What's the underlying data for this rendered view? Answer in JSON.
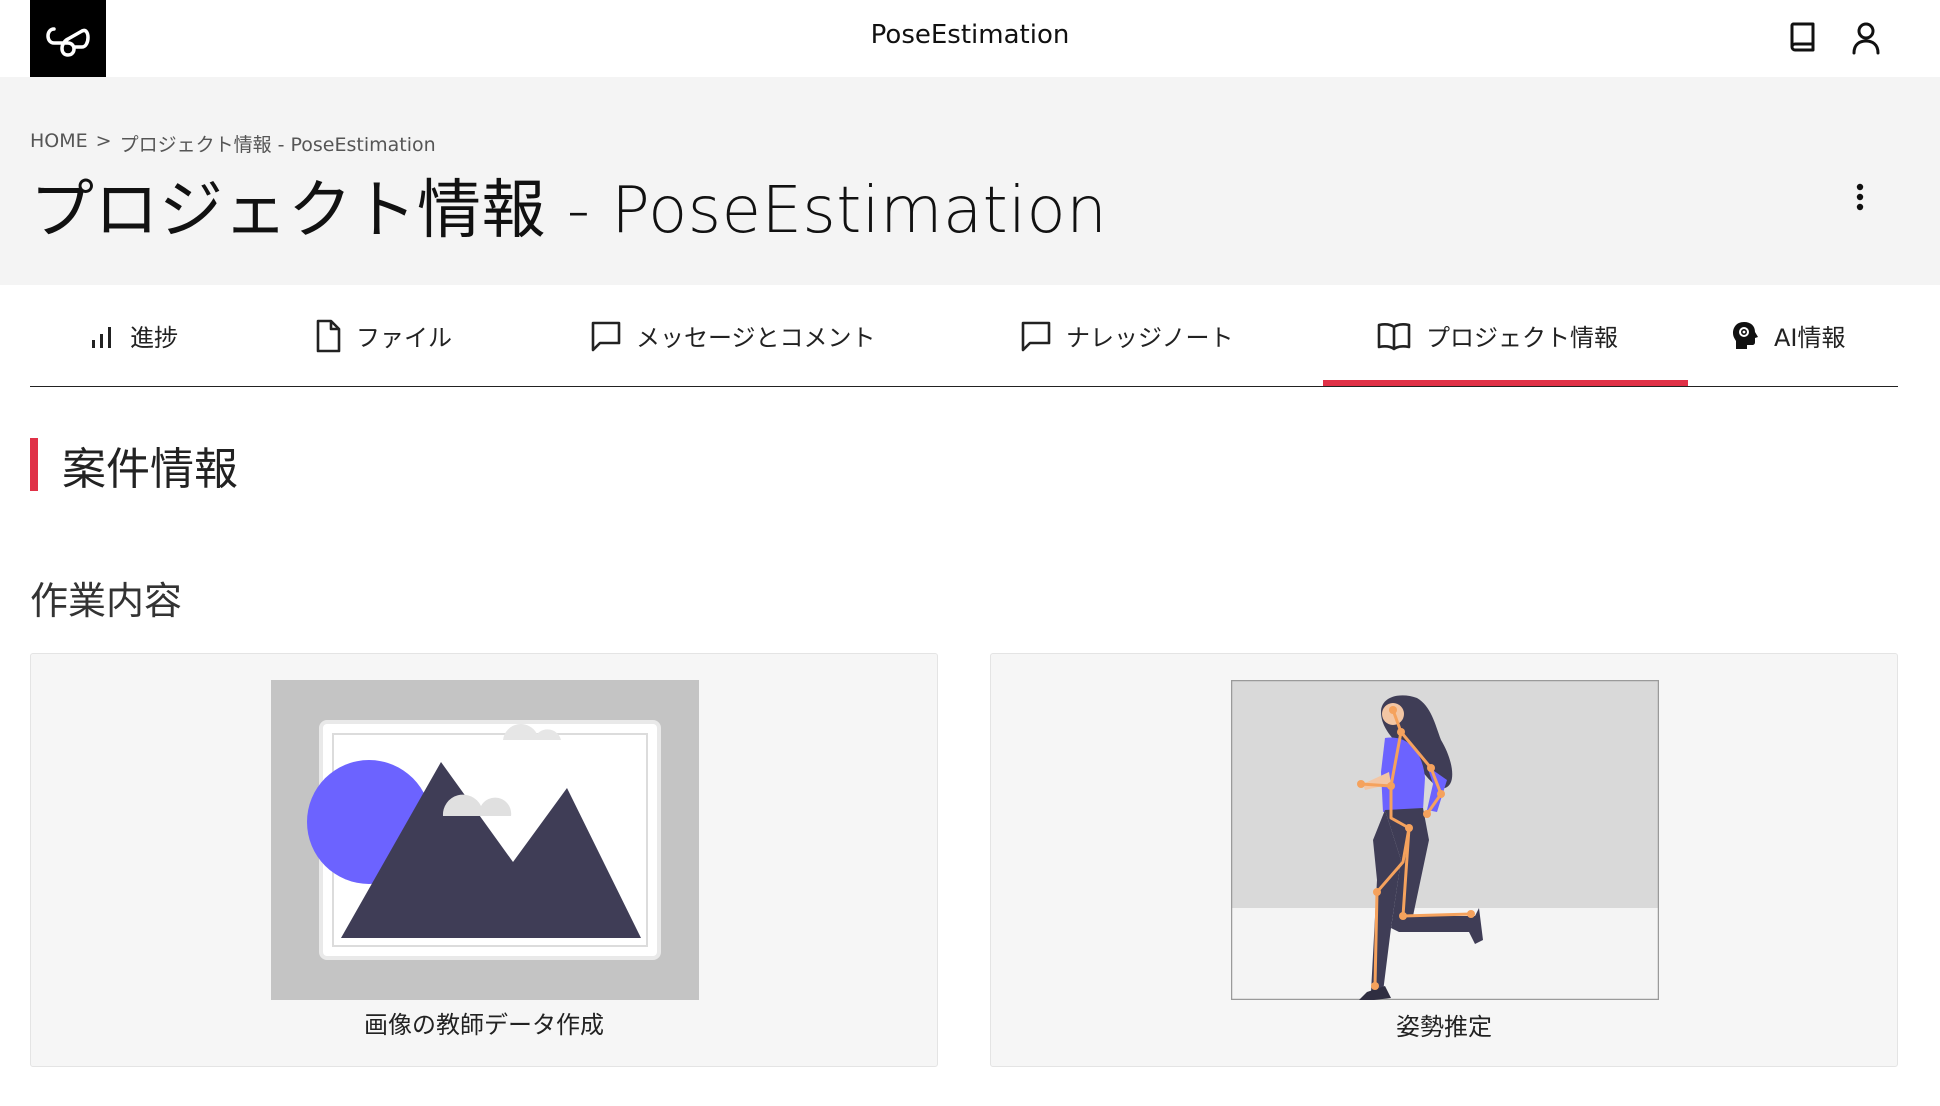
{
  "app": {
    "title": "PoseEstimation"
  },
  "breadcrumb": {
    "home": "HOME",
    "sep": ">",
    "current": "プロジェクト情報 - PoseEstimation"
  },
  "page": {
    "title": "プロジェクト情報 - PoseEstimation"
  },
  "tabs": [
    {
      "label": "進捗",
      "icon": "bar-chart-icon"
    },
    {
      "label": "ファイル",
      "icon": "file-icon"
    },
    {
      "label": "メッセージとコメント",
      "icon": "message-icon"
    },
    {
      "label": "ナレッジノート",
      "icon": "message-icon"
    },
    {
      "label": "プロジェクト情報",
      "icon": "open-book-icon",
      "active": true
    },
    {
      "label": "AI情報",
      "icon": "ai-head-icon"
    }
  ],
  "section": {
    "title": "案件情報"
  },
  "work": {
    "heading": "作業内容",
    "cards": [
      {
        "caption": "画像の教師データ作成",
        "illustration": "image-placeholder-illustration"
      },
      {
        "caption": "姿勢推定",
        "illustration": "pose-estimation-illustration"
      }
    ]
  },
  "colors": {
    "accent": "#e03147",
    "header_bg": "#f4f4f4",
    "card_bg": "#f6f6f6"
  }
}
